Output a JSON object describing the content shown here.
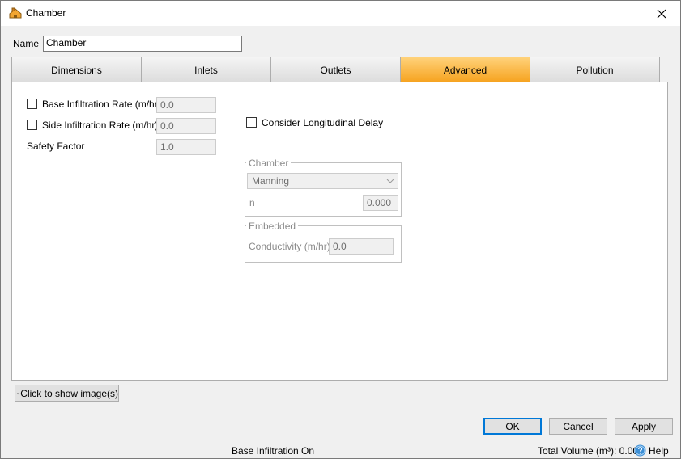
{
  "window": {
    "title": "Chamber"
  },
  "name_field": {
    "label": "Name",
    "value": "Chamber"
  },
  "tabs": [
    {
      "label": "Dimensions",
      "active": false
    },
    {
      "label": "Inlets",
      "active": false
    },
    {
      "label": "Outlets",
      "active": false
    },
    {
      "label": "Advanced",
      "active": true
    },
    {
      "label": "Pollution",
      "active": false
    }
  ],
  "advanced": {
    "base_infiltration": {
      "label": "Base Infiltration Rate (m/hr)",
      "value": "0.0",
      "checked": false
    },
    "side_infiltration": {
      "label": "Side Infiltration Rate (m/hr)",
      "value": "0.0",
      "checked": false
    },
    "safety_factor": {
      "label": "Safety Factor",
      "value": "1.0"
    },
    "longitudinal_delay": {
      "label": "Consider Longitudinal Delay",
      "checked": false
    },
    "chamber_group": {
      "title": "Chamber",
      "method": "Manning",
      "n_label": "n",
      "n_value": "0.000"
    },
    "embedded_group": {
      "title": "Embedded",
      "conductivity_label": "Conductivity (m/hr)",
      "conductivity_value": "0.0"
    }
  },
  "show_images_button": "Click to show image(s)",
  "buttons": {
    "ok": "OK",
    "cancel": "Cancel",
    "apply": "Apply"
  },
  "status": {
    "message": "Base Infiltration On",
    "total_volume": "Total Volume (m³): 0.000",
    "help": "Help"
  },
  "colors": {
    "active_tab": "#f6a21e",
    "default_button_border": "#0078d7",
    "help_icon": "#3c8fd6"
  }
}
